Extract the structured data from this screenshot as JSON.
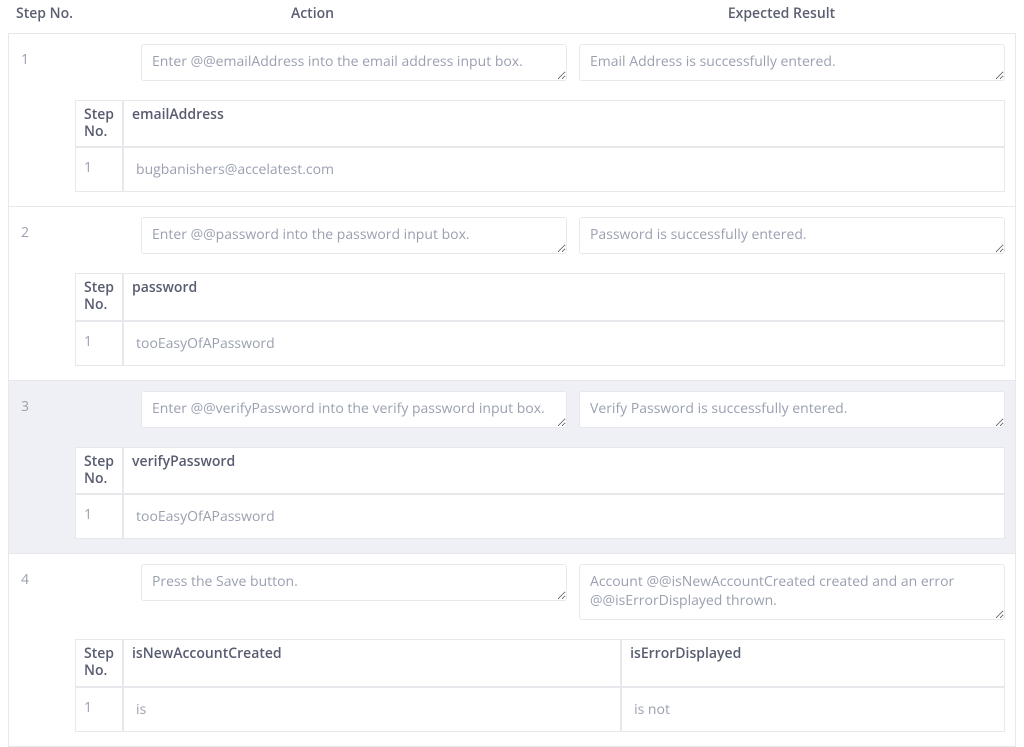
{
  "headers": {
    "step_no": "Step No.",
    "action": "Action",
    "expected": "Expected Result"
  },
  "inner": {
    "step_no": "Step\nNo."
  },
  "steps": [
    {
      "no": "1",
      "action": "Enter @@emailAddress into the email address input box.",
      "expected": "Email Address is successfully entered.",
      "selected": false,
      "vars": [
        {
          "name": "emailAddress",
          "rows": [
            {
              "no": "1",
              "value": "bugbanishers@accelatest.com"
            }
          ]
        }
      ]
    },
    {
      "no": "2",
      "action": "Enter @@password into the password input box.",
      "expected": "Password is successfully entered.",
      "selected": false,
      "vars": [
        {
          "name": "password",
          "rows": [
            {
              "no": "1",
              "value": "tooEasyOfAPassword"
            }
          ]
        }
      ]
    },
    {
      "no": "3",
      "action": "Enter @@verifyPassword into the verify password input box.",
      "expected": "Verify Password is successfully entered.",
      "selected": true,
      "vars": [
        {
          "name": "verifyPassword",
          "rows": [
            {
              "no": "1",
              "value": "tooEasyOfAPassword"
            }
          ]
        }
      ]
    },
    {
      "no": "4",
      "action": "Press the Save button.",
      "expected": "Account @@isNewAccountCreated created and an error @@isErrorDisplayed thrown.",
      "selected": false,
      "vars": [
        {
          "name": "isNewAccountCreated",
          "rows": [
            {
              "no": "1",
              "value": "is"
            }
          ]
        },
        {
          "name": "isErrorDisplayed",
          "rows": [
            {
              "no": "1",
              "value": "is not"
            }
          ]
        }
      ]
    }
  ]
}
